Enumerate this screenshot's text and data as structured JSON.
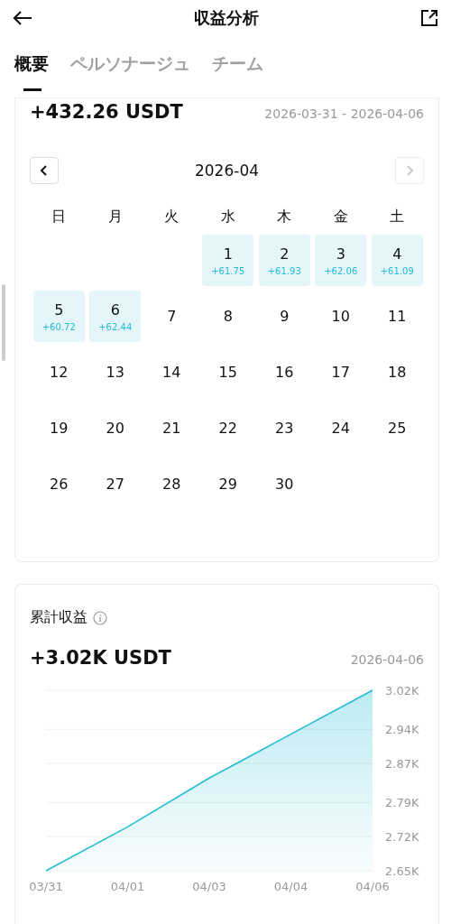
{
  "header": {
    "title": "収益分析"
  },
  "tabs": [
    {
      "label": "概要",
      "selected": true
    },
    {
      "label": "ペルソナージュ",
      "selected": false
    },
    {
      "label": "チーム",
      "selected": false
    }
  ],
  "period_card": {
    "amount": "+432.26 USDT",
    "date_range": "2026-03-31 - 2026-04-06",
    "calendar": {
      "month": "2026-04",
      "prev_disabled": false,
      "next_disabled": true,
      "weekdays": [
        "日",
        "月",
        "火",
        "水",
        "木",
        "金",
        "土"
      ],
      "weeks": [
        [
          {
            "kind": "blank"
          },
          {
            "kind": "blank"
          },
          {
            "kind": "blank"
          },
          {
            "kind": "day",
            "day": "1",
            "gain": "+61.75",
            "highlighted": true
          },
          {
            "kind": "day",
            "day": "2",
            "gain": "+61.93",
            "highlighted": true
          },
          {
            "kind": "day",
            "day": "3",
            "gain": "+62.06",
            "highlighted": true
          },
          {
            "kind": "day",
            "day": "4",
            "gain": "+61.09",
            "highlighted": true
          }
        ],
        [
          {
            "kind": "day",
            "day": "5",
            "gain": "+60.72",
            "highlighted": true
          },
          {
            "kind": "day",
            "day": "6",
            "gain": "+62.44",
            "highlighted": true
          },
          {
            "kind": "day",
            "day": "7",
            "highlighted": false
          },
          {
            "kind": "day",
            "day": "8",
            "highlighted": false
          },
          {
            "kind": "day",
            "day": "9",
            "highlighted": false
          },
          {
            "kind": "day",
            "day": "10",
            "highlighted": false
          },
          {
            "kind": "day",
            "day": "11",
            "highlighted": false
          }
        ],
        [
          {
            "kind": "day",
            "day": "12",
            "highlighted": false
          },
          {
            "kind": "day",
            "day": "13",
            "highlighted": false
          },
          {
            "kind": "day",
            "day": "14",
            "highlighted": false
          },
          {
            "kind": "day",
            "day": "15",
            "highlighted": false
          },
          {
            "kind": "day",
            "day": "16",
            "highlighted": false
          },
          {
            "kind": "day",
            "day": "17",
            "highlighted": false
          },
          {
            "kind": "day",
            "day": "18",
            "highlighted": false
          }
        ],
        [
          {
            "kind": "day",
            "day": "19",
            "highlighted": false
          },
          {
            "kind": "day",
            "day": "20",
            "highlighted": false
          },
          {
            "kind": "day",
            "day": "21",
            "highlighted": false
          },
          {
            "kind": "day",
            "day": "22",
            "highlighted": false
          },
          {
            "kind": "day",
            "day": "23",
            "highlighted": false
          },
          {
            "kind": "day",
            "day": "24",
            "highlighted": false
          },
          {
            "kind": "day",
            "day": "25",
            "highlighted": false
          }
        ],
        [
          {
            "kind": "day",
            "day": "26",
            "highlighted": false
          },
          {
            "kind": "day",
            "day": "27",
            "highlighted": false
          },
          {
            "kind": "day",
            "day": "28",
            "highlighted": false
          },
          {
            "kind": "day",
            "day": "29",
            "highlighted": false
          },
          {
            "kind": "day",
            "day": "30",
            "highlighted": false
          }
        ]
      ]
    }
  },
  "cumulative_card": {
    "title": "累計収益",
    "amount": "+3.02K USDT",
    "date": "2026-04-06",
    "chart_data": {
      "type": "area",
      "grid": true,
      "x": [
        "03/31",
        "04/01",
        "04/03",
        "04/04",
        "04/06"
      ],
      "series": [
        {
          "color": "#22bcd4",
          "values": [
            2.65,
            2.74,
            2.84,
            2.93,
            3.02
          ]
        }
      ],
      "ylim": [
        2.65,
        3.02
      ],
      "yticks": [
        {
          "value": 2.65,
          "label": "2.65K"
        },
        {
          "value": 2.72,
          "label": "2.72K"
        },
        {
          "value": 2.79,
          "label": "2.79K"
        },
        {
          "value": 2.87,
          "label": "2.87K"
        },
        {
          "value": 2.94,
          "label": "2.94K"
        },
        {
          "value": 3.02,
          "label": "3.02K"
        }
      ]
    }
  }
}
